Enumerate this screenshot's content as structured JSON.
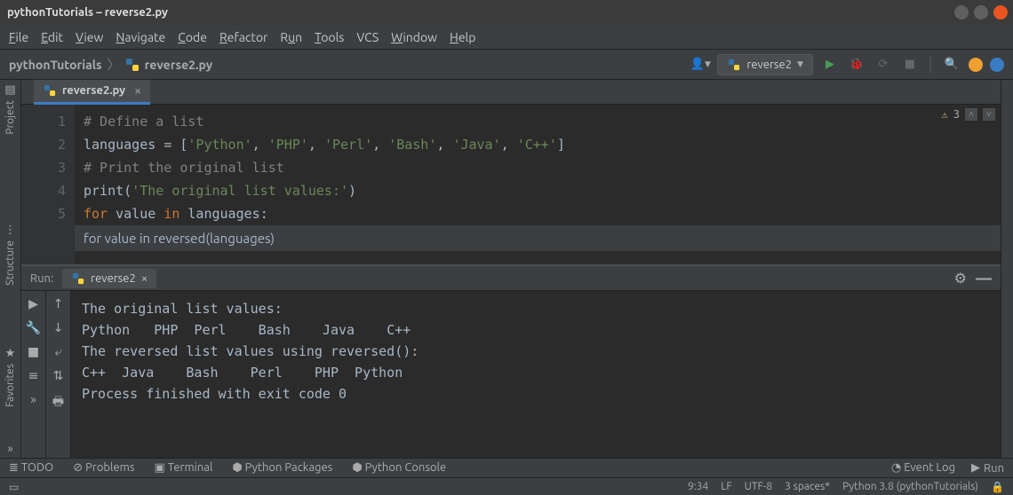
{
  "window": {
    "title": "pythonTutorials – reverse2.py"
  },
  "menu": {
    "file": "File",
    "edit": "Edit",
    "view": "View",
    "navigate": "Navigate",
    "code": "Code",
    "refactor": "Refactor",
    "run": "Run",
    "tools": "Tools",
    "vcs": "VCS",
    "window": "Window",
    "help": "Help"
  },
  "breadcrumb": {
    "project": "pythonTutorials",
    "file": "reverse2.py"
  },
  "run_config": {
    "name": "reverse2"
  },
  "tab": {
    "name": "reverse2.py"
  },
  "indicators": {
    "warn_count": "3"
  },
  "code_lines": {
    "n1": "1",
    "n2": "2",
    "n3": "3",
    "n4": "4",
    "n5": "5",
    "c1_comment": "# Define a list",
    "c2_var": "languages ",
    "c2_eq": "= [",
    "c2_s1": "'Python'",
    "c2_s2": "'PHP'",
    "c2_s3": "'Perl'",
    "c2_s4": "'Bash'",
    "c2_s5": "'Java'",
    "c2_s6": "'C++'",
    "c2_close": "]",
    "c3_comment": "# Print the original list",
    "c4_print": "print",
    "c4_open": "(",
    "c4_str": "'The original list values:'",
    "c4_close": ")",
    "c5_for": "for ",
    "c5_val": "value ",
    "c5_in": "in ",
    "c5_lang": "languages",
    "c5_colon": ":",
    "hint": "for value in reversed(languages)"
  },
  "sidebar": {
    "project": "Project",
    "structure": "Structure",
    "favorites": "Favorites"
  },
  "run_panel": {
    "title": "Run:",
    "tab": "reverse2",
    "output": {
      "l1": "The original list values:",
      "l2": "Python   PHP  Perl    Bash    Java    C++",
      "l3": "The reversed list values using reversed():",
      "l4": "C++  Java    Bash    Perl    PHP  Python",
      "l5": "Process finished with exit code 0"
    }
  },
  "bottom": {
    "todo": "TODO",
    "problems": "Problems",
    "terminal": "Terminal",
    "packages": "Python Packages",
    "console": "Python Console",
    "eventlog": "Event Log",
    "run": "Run"
  },
  "status": {
    "pos": "9:34",
    "lf": "LF",
    "enc": "UTF-8",
    "indent": "3 spaces*",
    "sdk": "Python 3.8 (pythonTutorials)"
  }
}
